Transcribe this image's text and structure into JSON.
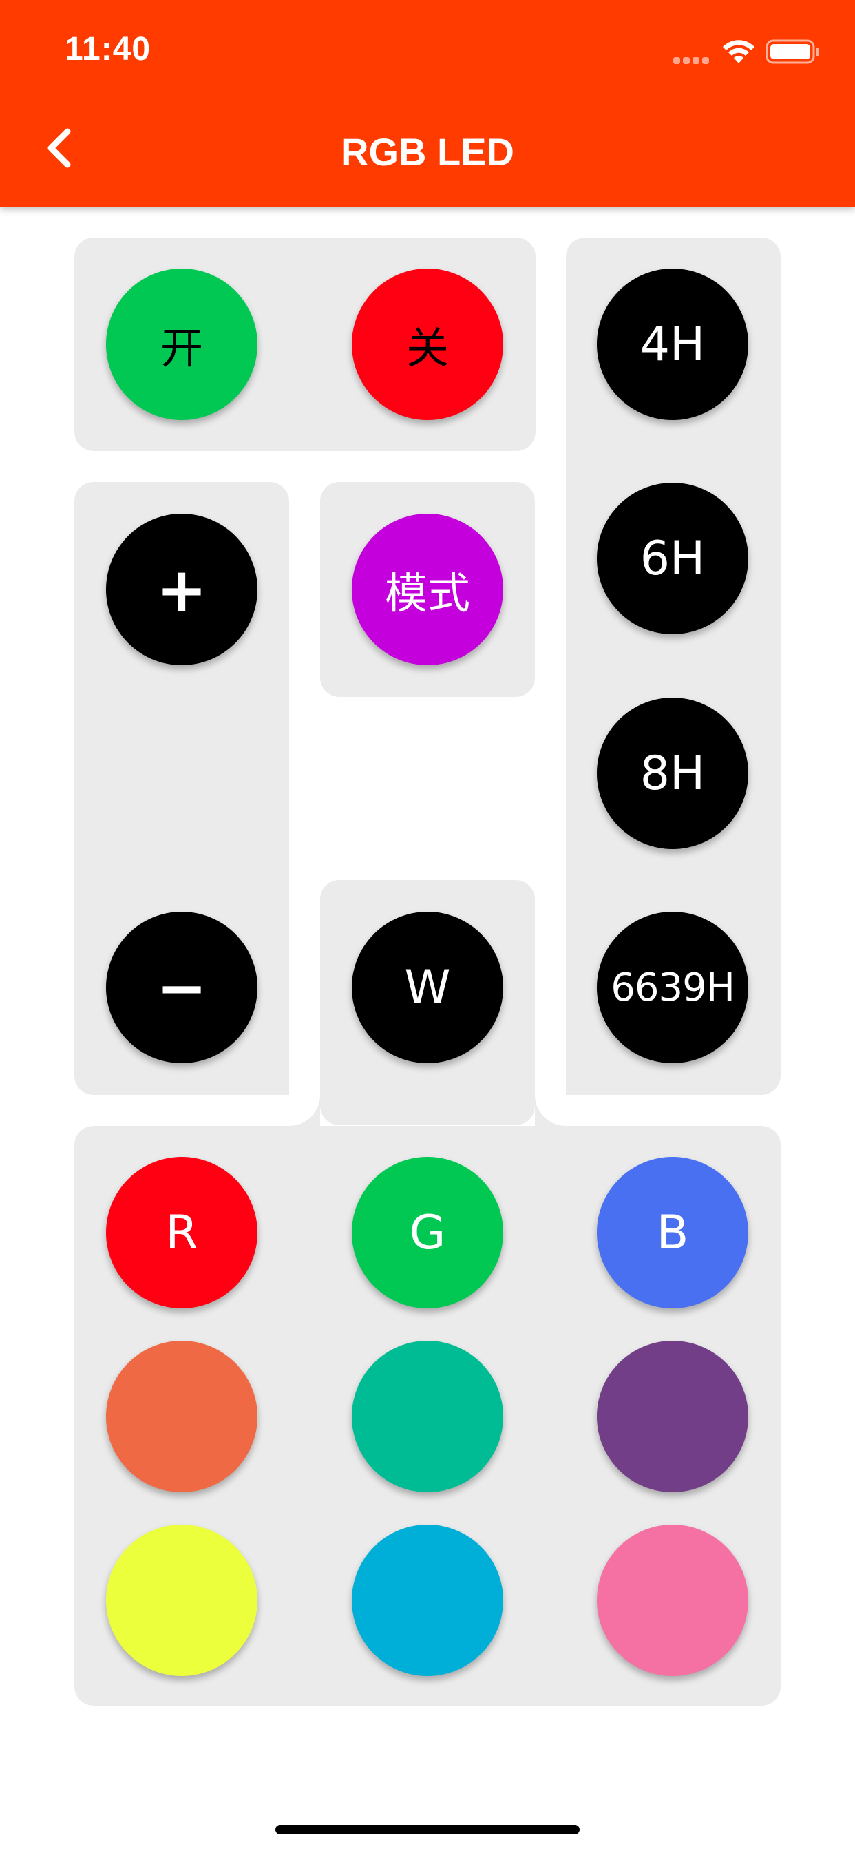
{
  "status_bar": {
    "time": "11:40"
  },
  "header": {
    "title": "RGB LED",
    "back_icon": "chevron-left-icon"
  },
  "colors": {
    "header": "#ff3b00",
    "panel": "#ebebeb",
    "on": "#00c853",
    "off": "#ff0012",
    "mode": "#c400dc",
    "black": "#000000"
  },
  "power": {
    "on_label": "开",
    "off_label": "关"
  },
  "brightness": {
    "up_label": "+",
    "down_label": "−"
  },
  "mode": {
    "label": "模式"
  },
  "white": {
    "label": "W"
  },
  "timers": [
    "4H",
    "6H",
    "8H",
    "6639H"
  ],
  "palette": [
    {
      "label": "R",
      "color": "#ff0012"
    },
    {
      "label": "G",
      "color": "#00c853"
    },
    {
      "label": "B",
      "color": "#4a70f2"
    },
    {
      "label": "",
      "color": "#ef6a44"
    },
    {
      "label": "",
      "color": "#00bc95"
    },
    {
      "label": "",
      "color": "#723e88"
    },
    {
      "label": "",
      "color": "#ebff3c"
    },
    {
      "label": "",
      "color": "#00afd8"
    },
    {
      "label": "",
      "color": "#f571a3"
    }
  ]
}
